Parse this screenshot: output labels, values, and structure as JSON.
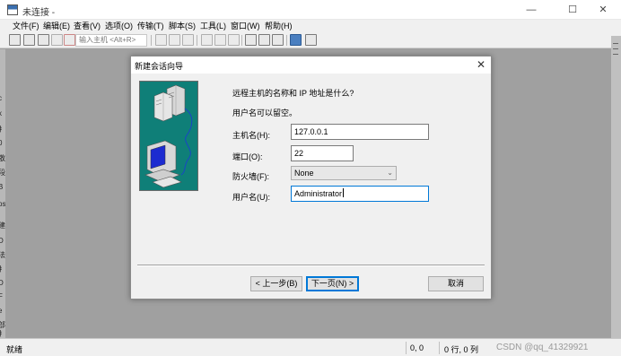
{
  "window": {
    "title": "未连接 -",
    "controls": {
      "minimize": "—",
      "maximize": "☐",
      "close": "✕"
    }
  },
  "menu": [
    {
      "label": "文件(F)",
      "name": "menu-file"
    },
    {
      "label": "编辑(E)",
      "name": "menu-edit"
    },
    {
      "label": "查看(V)",
      "name": "menu-view"
    },
    {
      "label": "选项(O)",
      "name": "menu-options"
    },
    {
      "label": "传输(T)",
      "name": "menu-transfer"
    },
    {
      "label": "脚本(S)",
      "name": "menu-script"
    },
    {
      "label": "工具(L)",
      "name": "menu-tools"
    },
    {
      "label": "窗口(W)",
      "name": "menu-window"
    },
    {
      "label": "帮助(H)",
      "name": "menu-help"
    }
  ],
  "toolbar": {
    "quick_connect_placeholder": "输入主机 <Alt+R>",
    "icons": [
      "connect-icon",
      "quick-connect-icon",
      "connect-tab-icon",
      "reconnect-icon",
      "disconnect-icon",
      "copy-icon",
      "paste-icon",
      "find-icon",
      "print-icon",
      "print-setup-icon",
      "log-icon",
      "session-options-icon",
      "global-options-icon",
      "keymap-icon",
      "help-icon",
      "about-icon"
    ]
  },
  "left_strip": [
    "c",
    "x",
    "扌",
    "0",
    "敬",
    "段",
    "B",
    "ps",
    "建",
    "D",
    "法",
    "扌",
    "D",
    "F",
    "e",
    "部",
    "扌",
    "第"
  ],
  "dialog": {
    "title": "新建会话向导",
    "close": "✕",
    "question": "远程主机的名称和 IP 地址是什么?",
    "hint": "用户名可以留空。",
    "hostname_label": "主机名(H):",
    "hostname_value": "127.0.0.1",
    "port_label": "端口(O):",
    "port_value": "22",
    "firewall_label": "防火墙(F):",
    "firewall_value": "None",
    "username_label": "用户名(U):",
    "username_value": "Administrator",
    "back_button": "< 上一步(B)",
    "next_button": "下一页(N) >",
    "cancel_button": "取消"
  },
  "status": {
    "ready": "就绪",
    "position": "0, 0",
    "rows_cols": "0 行, 0 列",
    "watermark": "CSDN @qq_41329921"
  }
}
